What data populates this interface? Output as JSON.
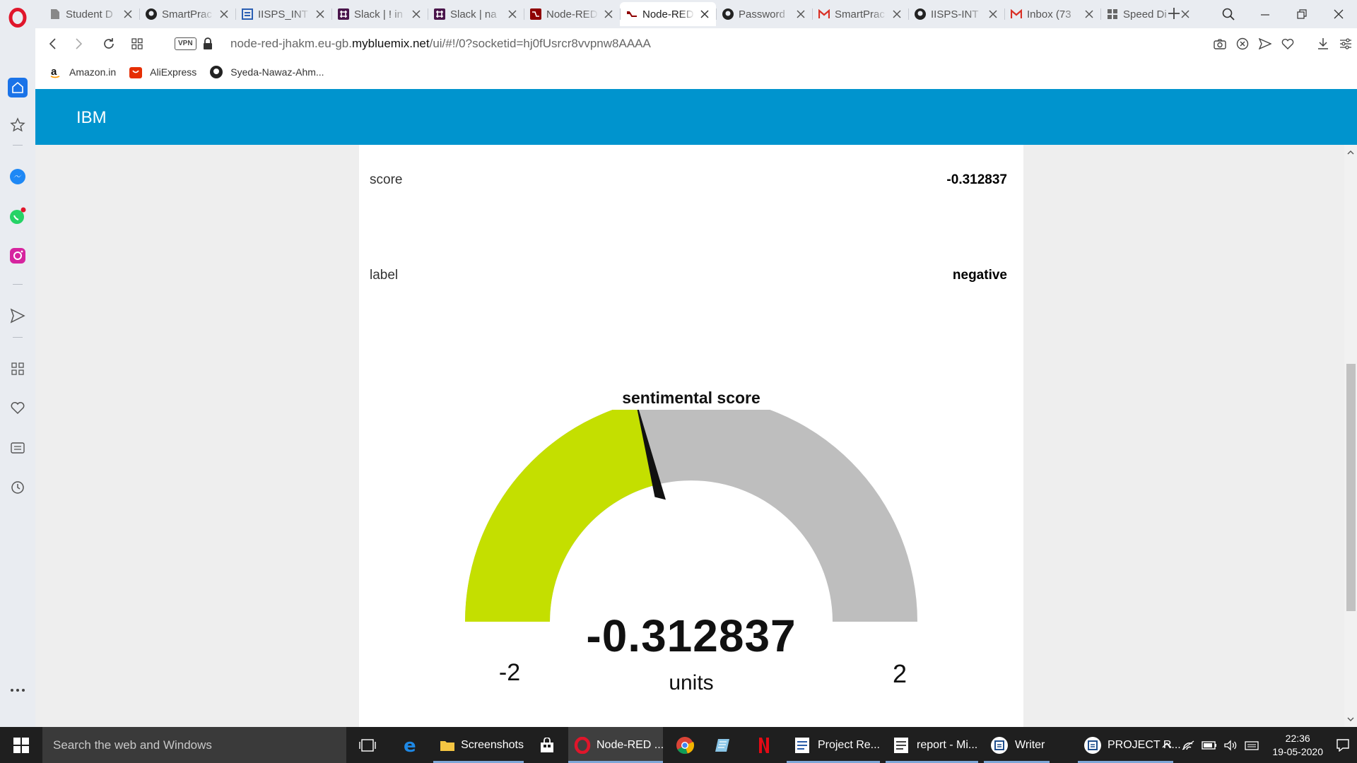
{
  "browser": {
    "tabs": [
      {
        "title": "Student D",
        "icon": "document-icon",
        "active": false
      },
      {
        "title": "SmartPrac",
        "icon": "github-icon",
        "active": false
      },
      {
        "title": "IISPS_INT",
        "icon": "word-doc-icon",
        "active": false
      },
      {
        "title": "Slack | ! in",
        "icon": "slack-icon",
        "active": false
      },
      {
        "title": "Slack | na",
        "icon": "slack-icon",
        "active": false
      },
      {
        "title": "Node-RED",
        "icon": "node-red-icon",
        "active": false
      },
      {
        "title": "Node-RED",
        "icon": "node-red-icon",
        "active": true
      },
      {
        "title": "Password",
        "icon": "github-icon",
        "active": false
      },
      {
        "title": "SmartPrac",
        "icon": "gmail-icon",
        "active": false
      },
      {
        "title": "IISPS-INT",
        "icon": "github-icon",
        "active": false
      },
      {
        "title": "Inbox (73",
        "icon": "gmail-icon",
        "active": false
      },
      {
        "title": "Speed Di",
        "icon": "speed-dial-icon",
        "active": false
      }
    ],
    "address": {
      "vpn_label": "VPN",
      "url_prefix": "node-red-jhakm.eu-gb.",
      "url_domain": "mybluemix.net",
      "url_path": "/ui/#!/0?socketid=hj0fUsrcr8vvpnw8AAAA"
    },
    "bookmarks": [
      {
        "label": "Amazon.in",
        "icon": "amazon-icon"
      },
      {
        "label": "AliExpress",
        "icon": "aliexpress-icon"
      },
      {
        "label": "Syeda-Nawaz-Ahm...",
        "icon": "github-icon"
      }
    ]
  },
  "dashboard": {
    "header_title": "IBM",
    "rows": [
      {
        "label": "score",
        "value": "-0.312837"
      },
      {
        "label": "label",
        "value": "negative"
      }
    ],
    "gauge": {
      "title": "sentimental score",
      "value": -0.312837,
      "value_text": "-0.312837",
      "units": "units",
      "min": -2,
      "max": 2,
      "min_text": "-2",
      "max_text": "2",
      "fill_color": "#c4df00",
      "track_color": "#bebebe",
      "needle_color": "#111111"
    }
  },
  "taskbar": {
    "search_placeholder": "Search the web and Windows",
    "items": [
      {
        "label": "Screenshots",
        "icon": "folder-icon"
      },
      {
        "label": "Node-RED ...",
        "icon": "opera-icon"
      },
      {
        "label": "Project Re...",
        "icon": "writer-doc-icon"
      },
      {
        "label": "report - Mi...",
        "icon": "word-icon"
      },
      {
        "label": "Writer",
        "icon": "writer-icon"
      },
      {
        "label": "PROJECT R...",
        "icon": "writer-doc-icon"
      }
    ],
    "time": "22:36",
    "date": "19-05-2020"
  }
}
